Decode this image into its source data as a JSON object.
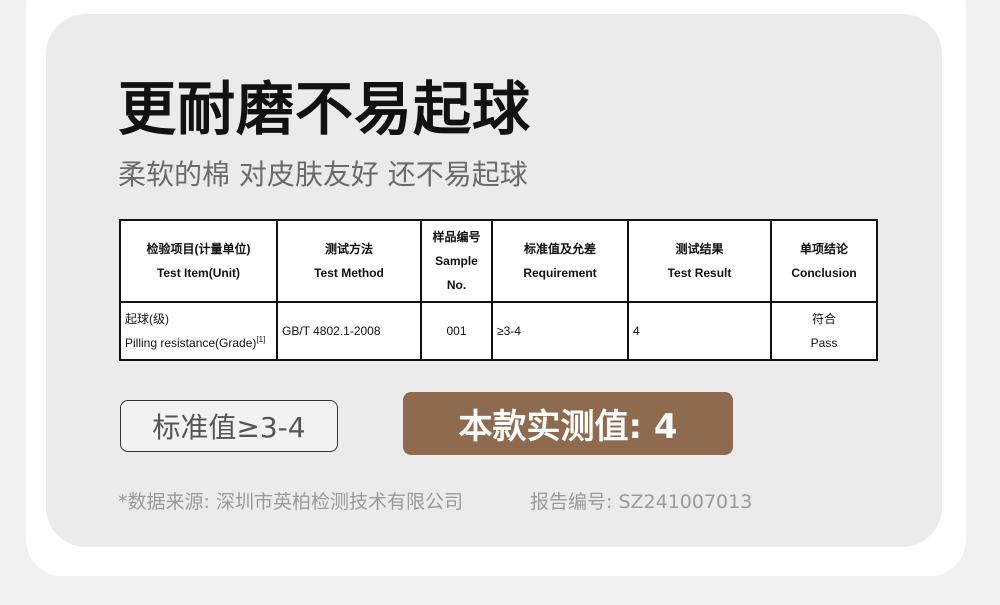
{
  "headline": "更耐磨不易起球",
  "subheadline": "柔软的棉 对皮肤友好 还不易起球",
  "table": {
    "headers": [
      {
        "cn": "检验项目(计量单位)",
        "en": "Test Item(Unit)"
      },
      {
        "cn": "测试方法",
        "en": "Test Method"
      },
      {
        "cn": "样品编号",
        "en": "Sample",
        "en2": "No."
      },
      {
        "cn": "标准值及允差",
        "en": "Requirement"
      },
      {
        "cn": "测试结果",
        "en": "Test Result"
      },
      {
        "cn": "单项结论",
        "en": "Conclusion"
      }
    ],
    "row": {
      "item_cn": "起球(级)",
      "item_en": "Pilling resistance(Grade)",
      "item_note": "[1]",
      "method": "GB/T 4802.1-2008",
      "sample_no": "001",
      "requirement": "≥3-4",
      "result": "4",
      "conclusion_cn": "符合",
      "conclusion_en": "Pass"
    }
  },
  "standard_badge": "标准值≥3-4",
  "result_badge": "本款实测值: 4",
  "data_source": "*数据来源: 深圳市英柏检测技术有限公司",
  "report_number": "报告编号: SZ241007013",
  "colors": {
    "accent": "#8e6b4e",
    "card_background": "#ebebeb",
    "page_background": "#f1f1f1"
  }
}
